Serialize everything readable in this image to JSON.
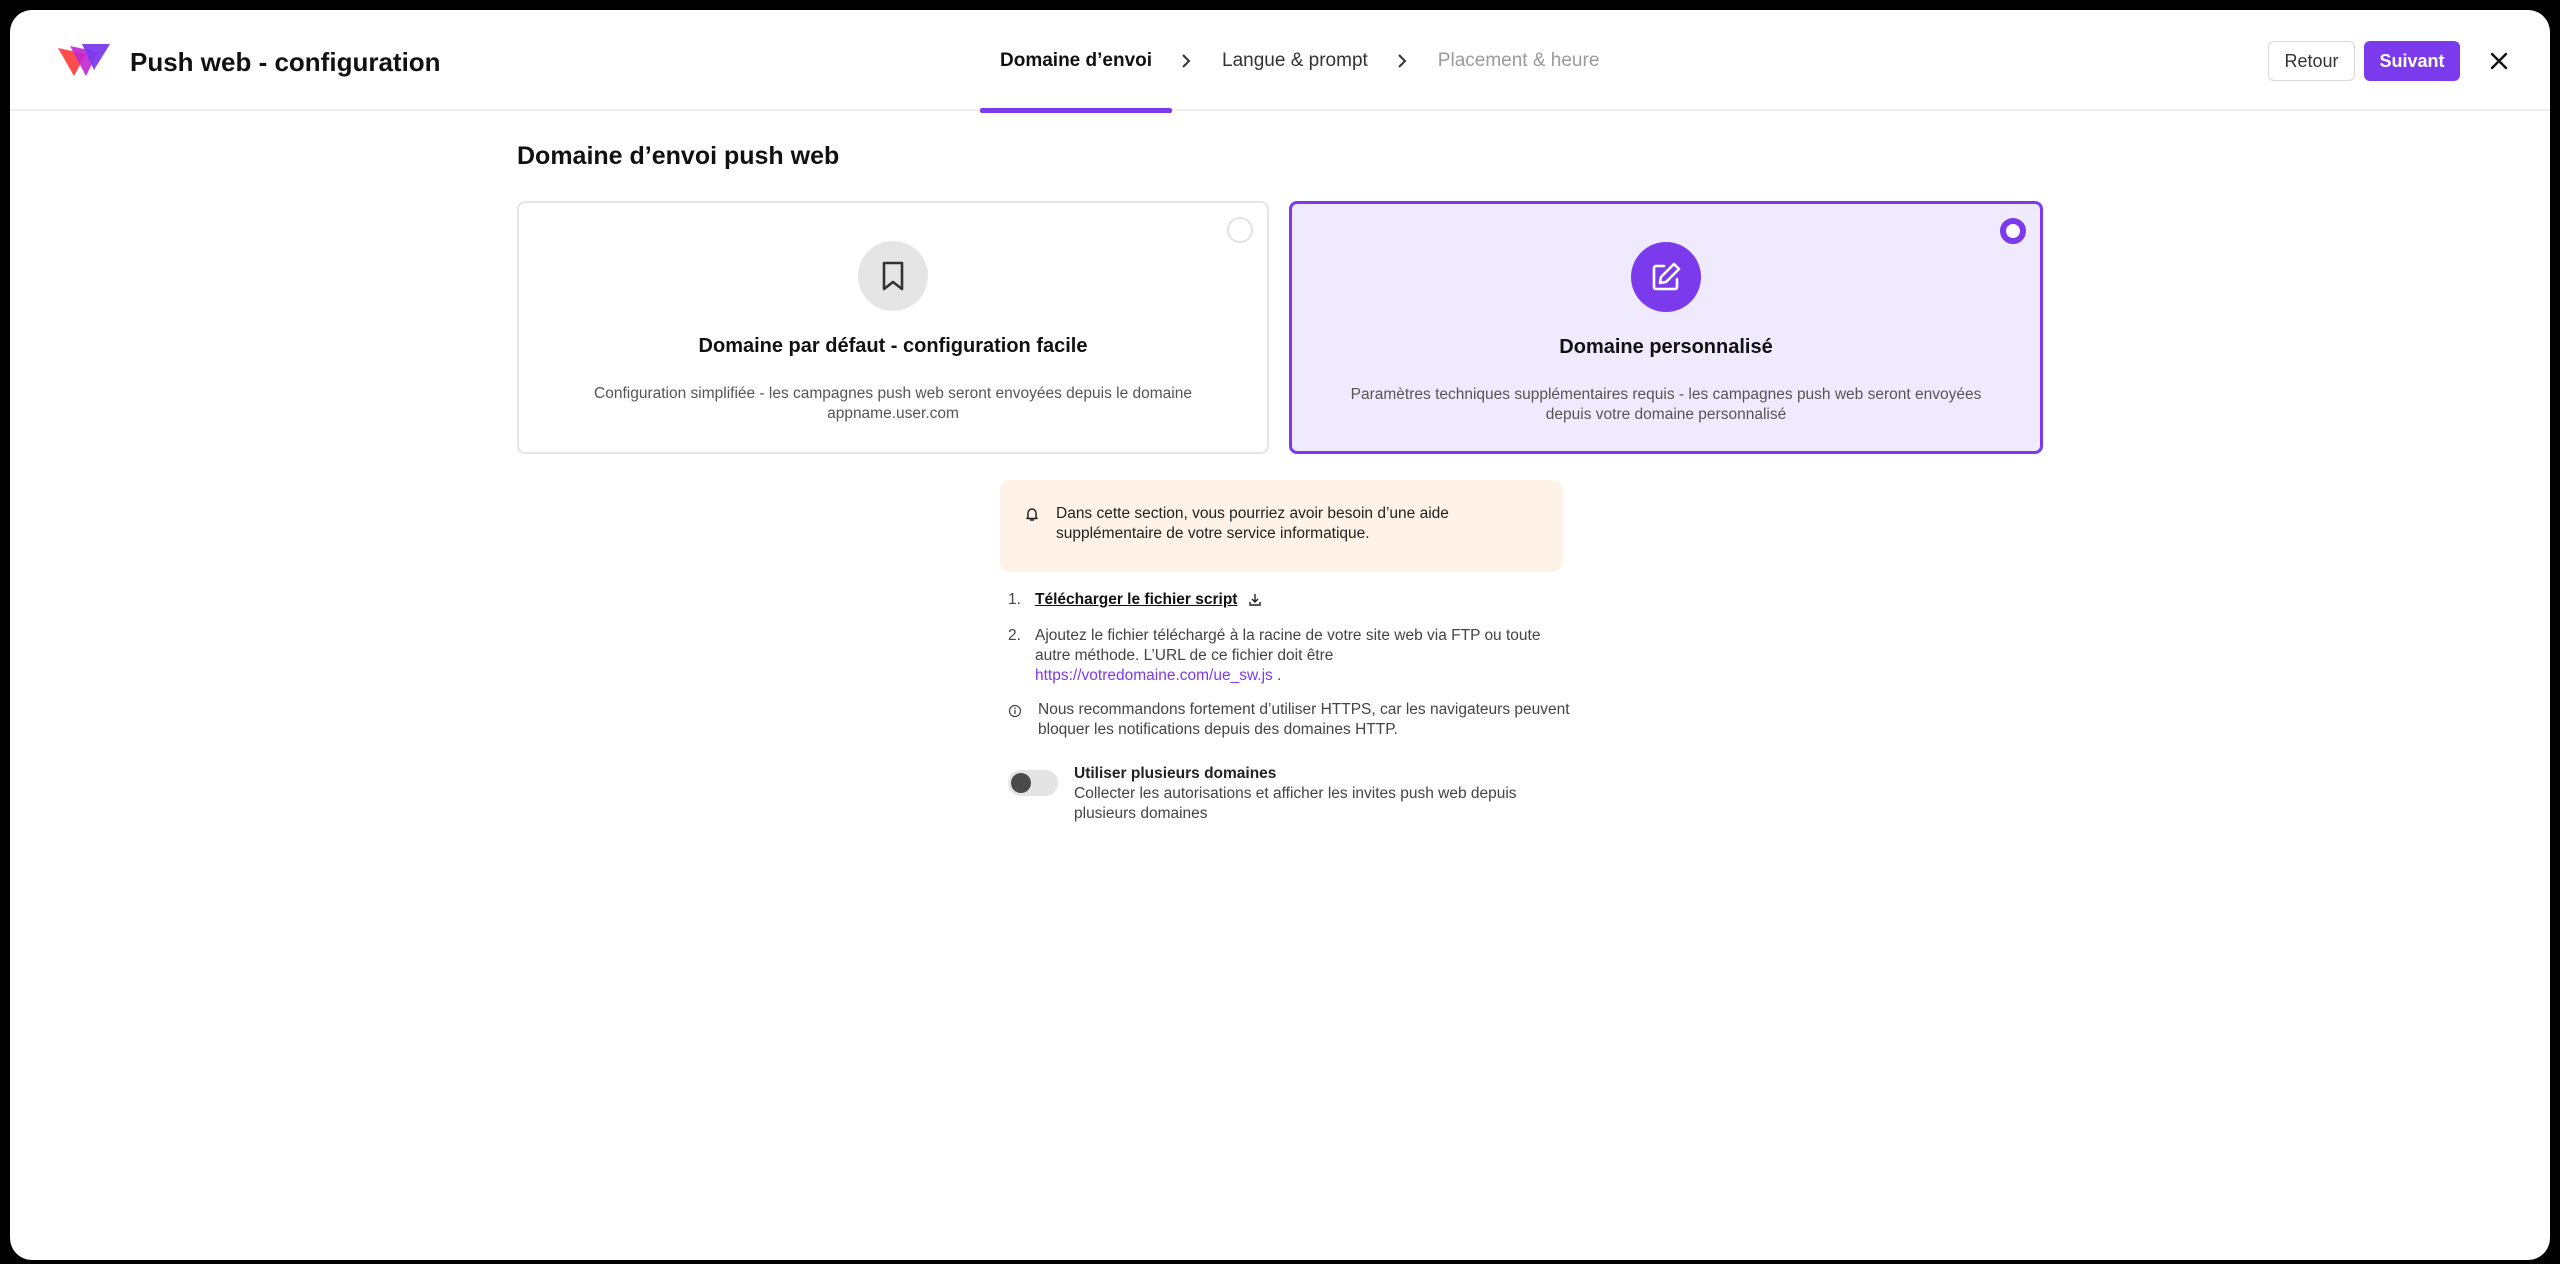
{
  "header": {
    "title": "Push web - configuration",
    "steps": [
      {
        "label": "Domaine d’envoi",
        "state": "active"
      },
      {
        "label": "Langue & prompt",
        "state": "normal"
      },
      {
        "label": "Placement & heure",
        "state": "disabled"
      }
    ],
    "back_label": "Retour",
    "next_label": "Suivant"
  },
  "section": {
    "title": "Domaine d’envoi push web"
  },
  "options": [
    {
      "title": "Domaine par défaut - configuration facile",
      "description": "Configuration simplifiée - les campagnes push web seront envoyées depuis le domaine appname.user.com",
      "icon": "bookmark-icon",
      "selected": false
    },
    {
      "title": "Domaine personnalisé",
      "description": "Paramètres techniques supplémentaires requis - les campagnes push web seront envoyées depuis votre domaine personnalisé",
      "icon": "edit-icon",
      "selected": true
    }
  ],
  "alert": {
    "text": "Dans cette section, vous pourriez avoir besoin d’une aide supplémentaire de votre service informatique.",
    "icon": "bell-icon"
  },
  "instructions": {
    "step1_num": "1.",
    "step1_link": "Télécharger le fichier script",
    "step2_num": "2.",
    "step2_text": "Ajoutez le fichier téléchargé à la racine de votre site web via FTP ou toute autre méthode. L’URL de ce fichier doit être",
    "step2_url": "https://votredomaine.com/ue_sw.js",
    "step2_suffix": " .",
    "note": "Nous recommandons fortement d’utiliser HTTPS, car les navigateurs peuvent bloquer les notifications depuis des domaines HTTP."
  },
  "multi_domain": {
    "title": "Utiliser plusieurs domaines",
    "description": "Collecter les autorisations et afficher les invites push web depuis plusieurs domaines",
    "enabled": false
  },
  "colors": {
    "accent": "#7c3aed",
    "selected_bg": "#efeafd",
    "alert_bg": "#fef3e6"
  }
}
